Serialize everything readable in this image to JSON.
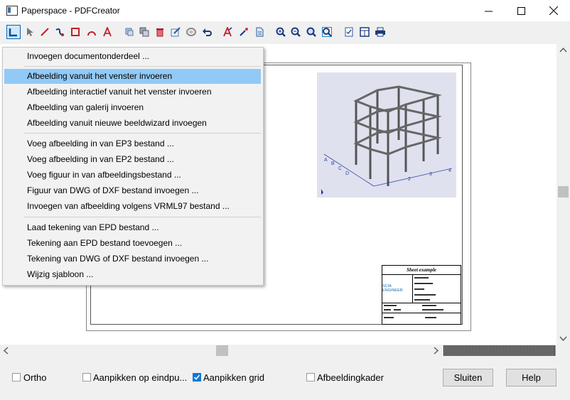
{
  "window": {
    "title": "Paperspace - PDFCreator"
  },
  "menu": {
    "items": [
      "Invoegen documentonderdeel ...",
      "Afbeelding vanuit het venster invoeren",
      "Afbeelding interactief vanuit het venster invoeren",
      "Afbeelding van galerij invoeren",
      "Afbeelding vanuit nieuwe beeldwizard invoegen",
      "Voeg afbeelding in van EP3 bestand ...",
      "Voeg afbeelding in van EP2 bestand ...",
      "Voeg figuur in van afbeeldingsbestand ...",
      "Figuur van DWG of DXF bestand invoegen ...",
      "Invoegen van afbeelding volgens VRML97 bestand ...",
      "Laad tekening van EPD bestand ...",
      "Tekening aan EPD bestand toevoegen ...",
      "Tekening van DWG of DXF bestand invoegen ...",
      "Wijzig sjabloon ..."
    ],
    "highlighted_index": 1
  },
  "titleblock": {
    "heading": "Sheet example",
    "logo": "SCIA ENGINEER"
  },
  "options": {
    "ortho": {
      "label": "Ortho",
      "checked": false
    },
    "snap_endpoints": {
      "label": "Aanpikken op eindpu...",
      "checked": false
    },
    "snap_grid": {
      "label": "Aanpikken grid",
      "checked": true
    },
    "image_frame": {
      "label": "Afbeeldingkader",
      "checked": false
    }
  },
  "buttons": {
    "close": "Sluiten",
    "help": "Help"
  },
  "colors": {
    "highlight": "#91c9f7",
    "accent": "#0a7ad4"
  }
}
